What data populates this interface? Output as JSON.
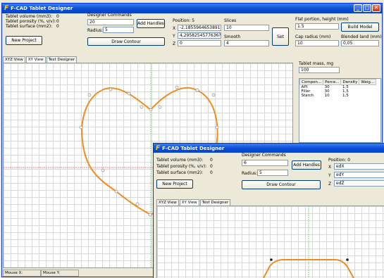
{
  "main": {
    "title": "F-CAD Tablet Designer",
    "window_buttons": [
      "_",
      "□",
      "✕"
    ],
    "info": {
      "volume_label": "Tablet volume (mm3):",
      "volume_value": "0",
      "porosity_label": "Tablet porosity (%, v/v):",
      "porosity_value": "0",
      "surface_label": "Tablet surface (mm2):",
      "surface_value": "0"
    },
    "new_project": "New Project",
    "designer_commands": "Designer Commands",
    "commands_value": "20",
    "radius_label": "Radius:",
    "radius_value": "5",
    "add_handles": "Add Handles",
    "draw_contour": "Draw Contour",
    "position_label": "Position: 5",
    "x_label": "X",
    "x_value": "-2,18559646538917E-7",
    "y_label": "Y",
    "y_value": "4,2958254577636?",
    "z_label": "Z",
    "z_value": "0",
    "slices_label": "Slices",
    "slices_value": "10",
    "smooth_label": "Smooth",
    "smooth_value": "4",
    "set": "Set",
    "flat_label": "Flat portion, height (mm)",
    "flat_value": "1.5",
    "build_model": "Build Model",
    "cap_label": "Cap radius (mm)",
    "cap_value": "10",
    "blended_label": "Blended land (mm)",
    "blended_value": "0,05",
    "tabs": [
      "XYZ View",
      "XY View",
      "Text Designer"
    ],
    "mass_label": "Tablet mass, mg",
    "mass_value": "100",
    "table_headers": [
      "Compon...",
      "Perce...",
      "Density",
      "Weig..."
    ],
    "table_rows": [
      [
        "API",
        "30",
        "1,5",
        ""
      ],
      [
        "Filler",
        "30",
        "1,5",
        ""
      ],
      [
        "Starch",
        "10",
        "1,5",
        ""
      ]
    ],
    "mouse_x": "Mouse X:",
    "mouse_y": "Mouse Y:"
  },
  "second": {
    "title": "F-CAD Tablet Designer",
    "info": {
      "volume_label": "Tablet volume (mm3):",
      "volume_value": "0",
      "porosity_label": "Tablet porosity (%, v/v):",
      "porosity_value": "0",
      "surface_label": "Tablet surface (mm2):",
      "surface_value": "0"
    },
    "new_project": "New Project",
    "designer_commands": "Designer Commands",
    "commands_value": "6",
    "radius_label": "Radius:",
    "radius_value": "5",
    "add_handles": "Add Handles",
    "draw_contour": "Draw Contour",
    "position_label": "Position: 0",
    "x_label": "X",
    "x_value": "edX",
    "y_label": "Y",
    "y_value": "edY",
    "z_label": "Z",
    "z_value": "edZ",
    "tabs": [
      "XYZ View",
      "XY View",
      "Text Designer"
    ]
  },
  "colors": {
    "contour": "#f28a1e",
    "axis_green": "#7ad97a",
    "axis_red": "#e08080"
  }
}
